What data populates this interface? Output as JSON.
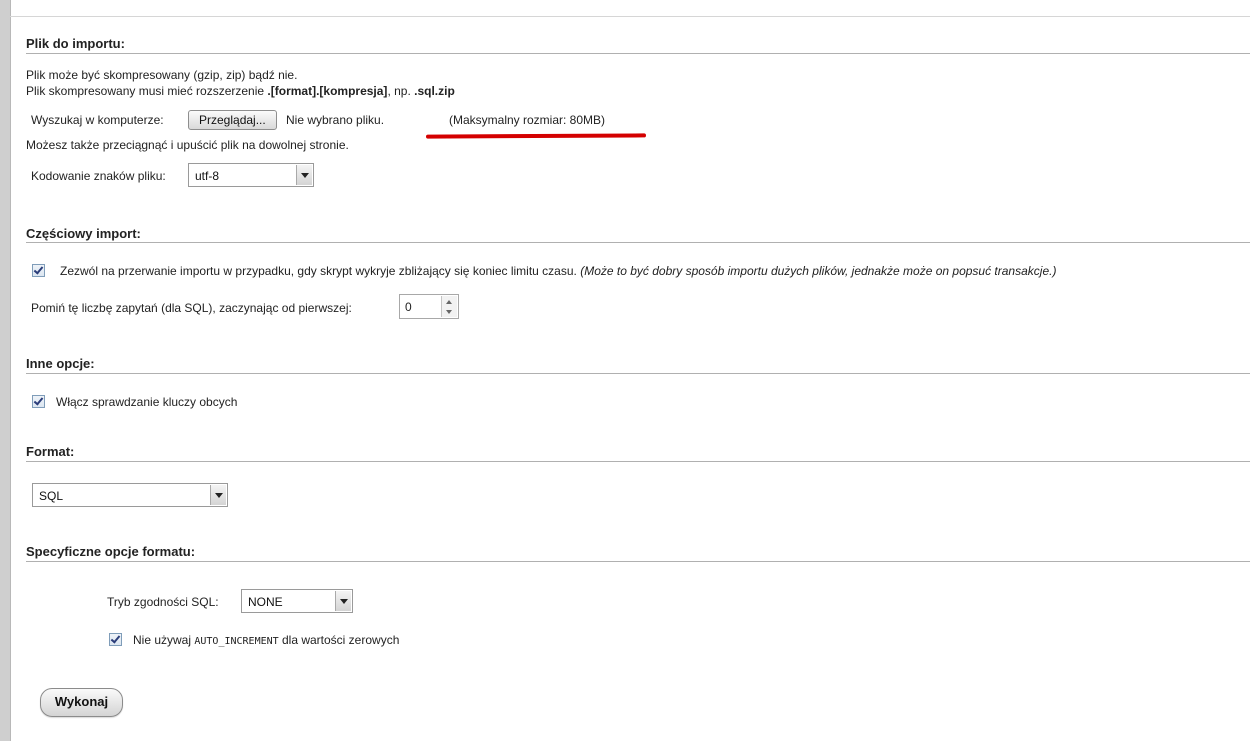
{
  "import_file": {
    "title": "Plik do importu:",
    "line1": "Plik może być skompresowany (gzip, zip) bądź nie.",
    "line2_prefix": "Plik skompresowany musi mieć rozszerzenie ",
    "line2_bold": ".[format].[kompresja]",
    "line2_mid": ", np. ",
    "line2_bold2": ".sql.zip",
    "browse_label": "Wyszukaj w komputerze:",
    "browse_button": "Przeglądaj...",
    "no_file": "Nie wybrano pliku.",
    "max_size": "(Maksymalny rozmiar: 80MB)",
    "drag_hint": "Możesz także przeciągnąć i upuścić plik na dowolnej stronie.",
    "charset_label": "Kodowanie znaków pliku:",
    "charset_value": "utf-8"
  },
  "partial_import": {
    "title": "Częściowy import:",
    "allow_interrupt_text": "Zezwól na przerwanie importu w przypadku, gdy skrypt wykryje zbliżający się koniec limitu czasu.",
    "allow_interrupt_note": "(Może to być dobry sposób importu dużych plików, jednakże może on popsuć transakcje.)",
    "skip_label": "Pomiń tę liczbę zapytań (dla SQL), zaczynając od pierwszej:",
    "skip_value": "0"
  },
  "other_options": {
    "title": "Inne opcje:",
    "foreign_keys": "Włącz sprawdzanie kluczy obcych"
  },
  "format": {
    "title": "Format:",
    "value": "SQL"
  },
  "format_specific": {
    "title": "Specyficzne opcje formatu:",
    "compat_label": "Tryb zgodności SQL:",
    "compat_value": "NONE",
    "auto_inc_prefix": "Nie używaj ",
    "auto_inc_code": "AUTO_INCREMENT",
    "auto_inc_suffix": " dla wartości zerowych"
  },
  "submit": {
    "label": "Wykonaj"
  },
  "colors": {
    "annotation_underline": "#d40000",
    "rule": "#b0b0b0"
  }
}
